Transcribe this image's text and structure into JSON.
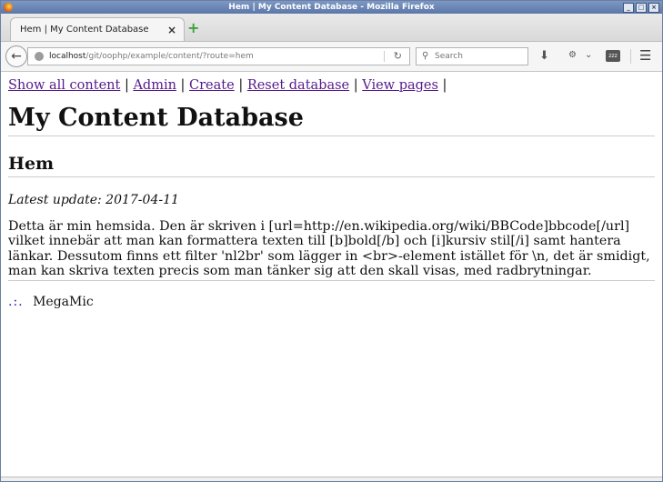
{
  "window": {
    "title": "Hem | My Content Database - Mozilla Firefox"
  },
  "tab": {
    "label": "Hem | My Content Database",
    "close": "×"
  },
  "navbar": {
    "url_host": "localhost",
    "url_path": "/git/oophp/example/content/?route=hem",
    "search_placeholder": "Search"
  },
  "links": [
    "Show all content",
    "Admin",
    "Create",
    "Reset database",
    "View pages"
  ],
  "page": {
    "title": "My Content Database",
    "subtitle": "Hem",
    "updated": "Latest update: 2017-04-11",
    "body": "Detta är min hemsida. Den är skriven i [url=http://en.wikipedia.org/wiki/BBCode]bbcode[/url] vilket innebär att man kan formattera texten till [b]bold[/b] och [i]kursiv stil[/i] samt hantera länkar. Dessutom finns ett filter 'nl2br' som lägger in <br>-element istället för \\n, det är smidigt, man kan skriva texten precis som man tänker sig att den skall visas, med radbrytningar.",
    "footer_dots": ".:.",
    "footer_text": "MegaMic"
  },
  "colors": {
    "link": "#551a8b",
    "accent": "#2020c0"
  }
}
